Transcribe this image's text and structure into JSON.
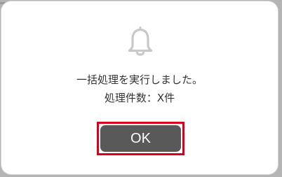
{
  "dialog": {
    "icon": "bell-icon",
    "message_line1": "一括処理を実行しました。",
    "message_line2": "処理件数：X件",
    "ok_label": "OK"
  },
  "colors": {
    "backdrop": "#b4b4b4",
    "dialog_background": "#ffffff",
    "icon": "#c8c8c8",
    "text": "#333333",
    "button_background": "#595959",
    "button_text": "#ffffff",
    "highlight": "#d9001b"
  }
}
